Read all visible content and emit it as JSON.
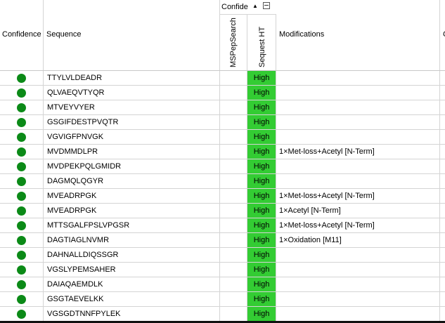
{
  "header": {
    "confidence_label": "Confidence",
    "sequence_label": "Sequence",
    "group_label": "Confide",
    "mspepsearch_label": "MSPepSearch",
    "sequestht_label": "Sequest HT",
    "modifications_label": "Modifications",
    "last_label": "C"
  },
  "icons": {
    "sort": "sort-up-icon",
    "collapse": "collapse-minus-icon",
    "confidence": "green-circle-icon"
  },
  "colors": {
    "high_bg": "#33cc33",
    "dot": "#0b8a17"
  },
  "rows": [
    {
      "sequence": "TTYLVLDEADR",
      "sequest": "High",
      "modifications": ""
    },
    {
      "sequence": "QLVAEQVTYQR",
      "sequest": "High",
      "modifications": ""
    },
    {
      "sequence": "MTVEYVYER",
      "sequest": "High",
      "modifications": ""
    },
    {
      "sequence": "GSGIFDESTPVQTR",
      "sequest": "High",
      "modifications": ""
    },
    {
      "sequence": "VGVIGFPNVGK",
      "sequest": "High",
      "modifications": ""
    },
    {
      "sequence": "MVDMMDLPR",
      "sequest": "High",
      "modifications": "1×Met-loss+Acetyl [N-Term]"
    },
    {
      "sequence": "MVDPEKPQLGMIDR",
      "sequest": "High",
      "modifications": ""
    },
    {
      "sequence": "DAGMQLQGYR",
      "sequest": "High",
      "modifications": ""
    },
    {
      "sequence": "MVEADRPGK",
      "sequest": "High",
      "modifications": "1×Met-loss+Acetyl [N-Term]"
    },
    {
      "sequence": "MVEADRPGK",
      "sequest": "High",
      "modifications": "1×Acetyl [N-Term]"
    },
    {
      "sequence": "MTTSGALFPSLVPGSR",
      "sequest": "High",
      "modifications": "1×Met-loss+Acetyl [N-Term]"
    },
    {
      "sequence": "DAGTIAGLNVMR",
      "sequest": "High",
      "modifications": "1×Oxidation [M11]"
    },
    {
      "sequence": "DAHNALLDIQSSGR",
      "sequest": "High",
      "modifications": ""
    },
    {
      "sequence": "VGSLYPEMSAHER",
      "sequest": "High",
      "modifications": ""
    },
    {
      "sequence": "DAIAQAEMDLK",
      "sequest": "High",
      "modifications": ""
    },
    {
      "sequence": "GSGTAEVELKK",
      "sequest": "High",
      "modifications": ""
    },
    {
      "sequence": "VGSGDTNNFPYLEK",
      "sequest": "High",
      "modifications": ""
    }
  ]
}
